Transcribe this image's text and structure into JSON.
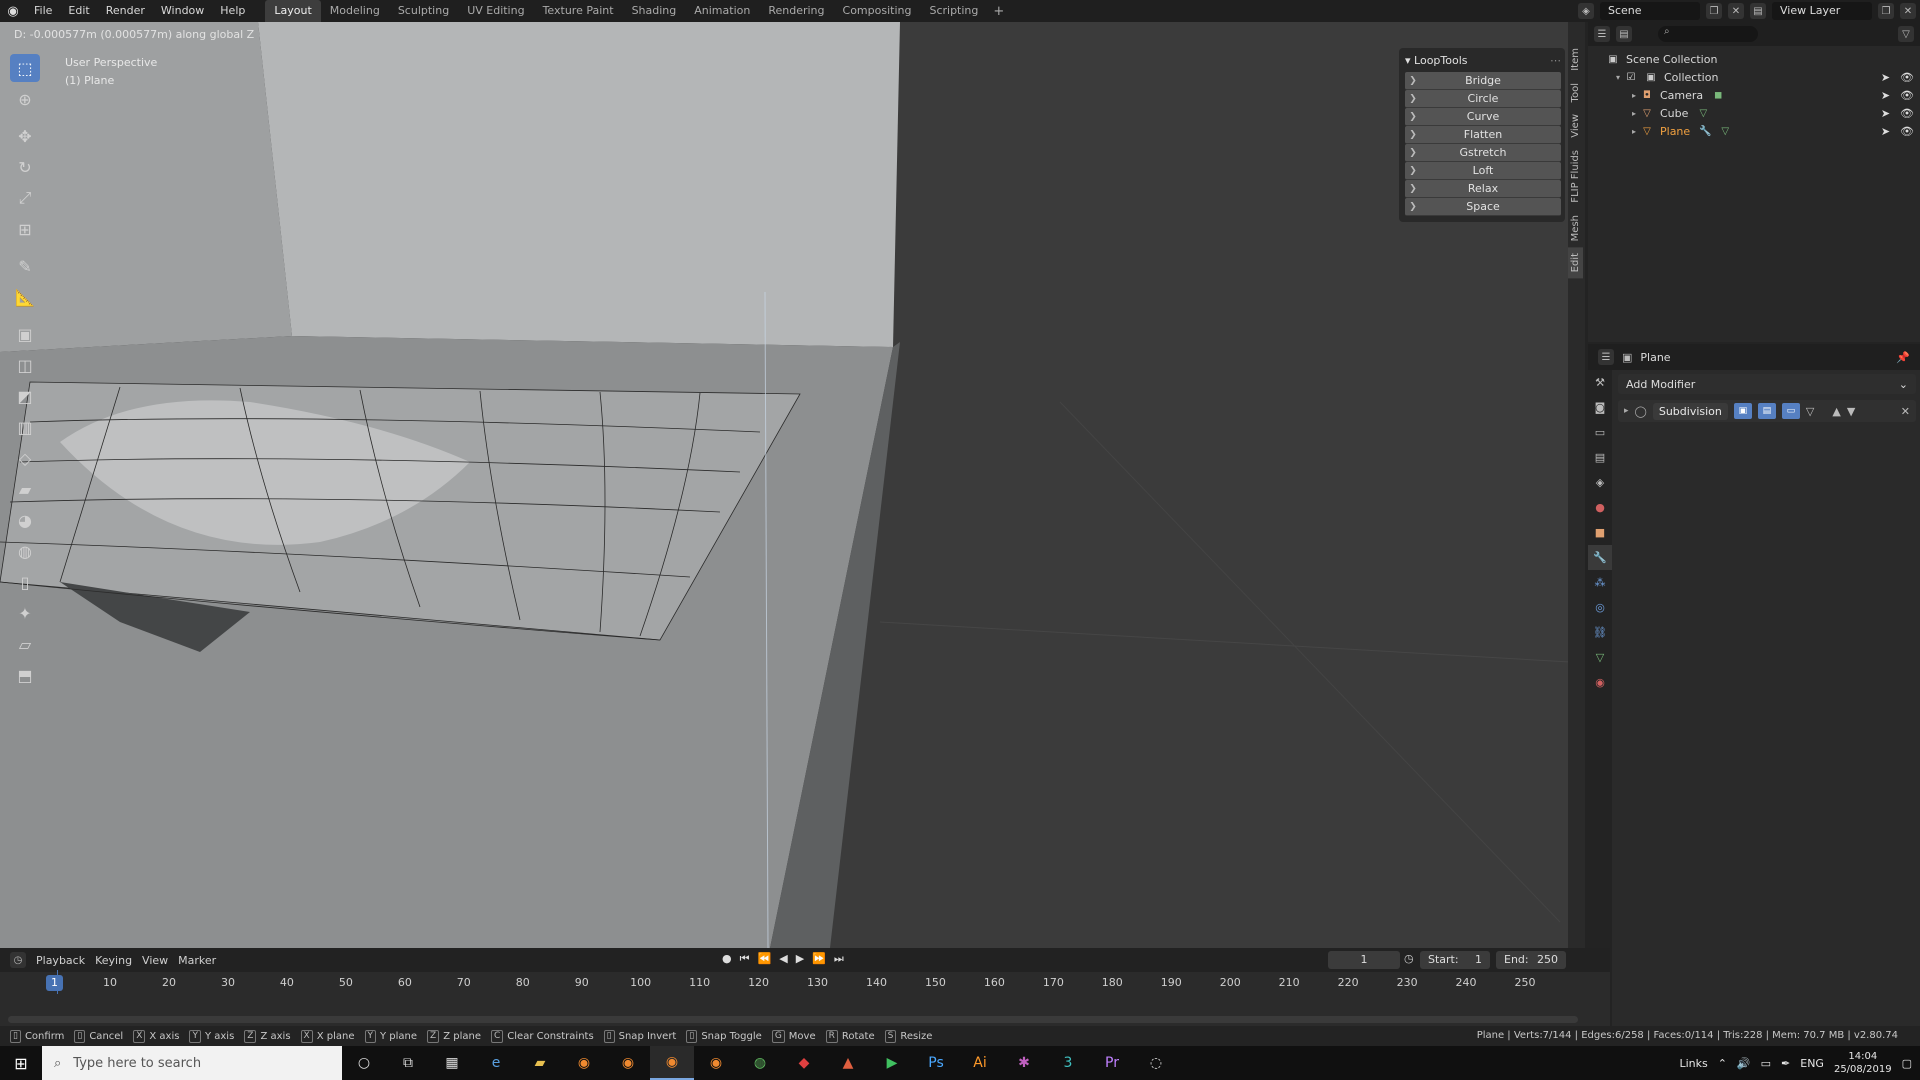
{
  "menubar": {
    "items": [
      "File",
      "Edit",
      "Render",
      "Window",
      "Help"
    ],
    "workspaces": [
      "Layout",
      "Modeling",
      "Sculpting",
      "UV Editing",
      "Texture Paint",
      "Shading",
      "Animation",
      "Rendering",
      "Compositing",
      "Scripting"
    ],
    "active_workspace": "Layout",
    "add_tab": "+",
    "scene": "Scene",
    "view_layer": "View Layer"
  },
  "viewport": {
    "operator_text": "D: -0.000577m (0.000577m) along global Z",
    "perspective": "User Perspective",
    "object": "(1) Plane"
  },
  "looptools": {
    "title": "LoopTools",
    "items": [
      "Bridge",
      "Circle",
      "Curve",
      "Flatten",
      "Gstretch",
      "Loft",
      "Relax",
      "Space"
    ]
  },
  "sidebar_tabs": [
    "Item",
    "Tool",
    "View",
    "FLIP Fluids",
    "Mesh",
    "Edit"
  ],
  "outliner": {
    "root": "Scene Collection",
    "collection": "Collection",
    "objects": [
      {
        "name": "Camera",
        "color": "#e0a070"
      },
      {
        "name": "Cube",
        "color": "#e0a070"
      },
      {
        "name": "Plane",
        "color": "#f0a040"
      }
    ]
  },
  "properties": {
    "object_name": "Plane",
    "add_modifier": "Add Modifier",
    "modifier": "Subdivision"
  },
  "timeline": {
    "menus": [
      "Playback",
      "Keying",
      "View",
      "Marker"
    ],
    "current_frame": "1",
    "start_label": "Start:",
    "start": "1",
    "end_label": "End:",
    "end": "250",
    "ticks": [
      "10",
      "20",
      "30",
      "40",
      "50",
      "60",
      "70",
      "80",
      "90",
      "100",
      "110",
      "120",
      "130",
      "140",
      "150",
      "160",
      "170",
      "180",
      "190",
      "200",
      "210",
      "220",
      "230",
      "240",
      "250"
    ]
  },
  "statusbar": {
    "items": [
      {
        "key": "",
        "label": "Confirm"
      },
      {
        "key": "",
        "label": "Cancel"
      },
      {
        "key": "X",
        "label": "X axis"
      },
      {
        "key": "Y",
        "label": "Y axis"
      },
      {
        "key": "Z",
        "label": "Z axis"
      },
      {
        "key": "X",
        "label": "X plane"
      },
      {
        "key": "Y",
        "label": "Y plane"
      },
      {
        "key": "Z",
        "label": "Z plane"
      },
      {
        "key": "C",
        "label": "Clear Constraints"
      },
      {
        "key": "",
        "label": "Snap Invert"
      },
      {
        "key": "",
        "label": "Snap Toggle"
      },
      {
        "key": "G",
        "label": "Move"
      },
      {
        "key": "R",
        "label": "Rotate"
      },
      {
        "key": "S",
        "label": "Resize"
      }
    ],
    "stats": "Plane | Verts:7/144 | Edges:6/258 | Faces:0/114 | Tris:228 | Mem: 70.7 MB | v2.80.74"
  },
  "taskbar": {
    "search_placeholder": "Type here to search",
    "links": "Links",
    "lang": "ENG",
    "time": "14:04",
    "date": "25/08/2019"
  }
}
